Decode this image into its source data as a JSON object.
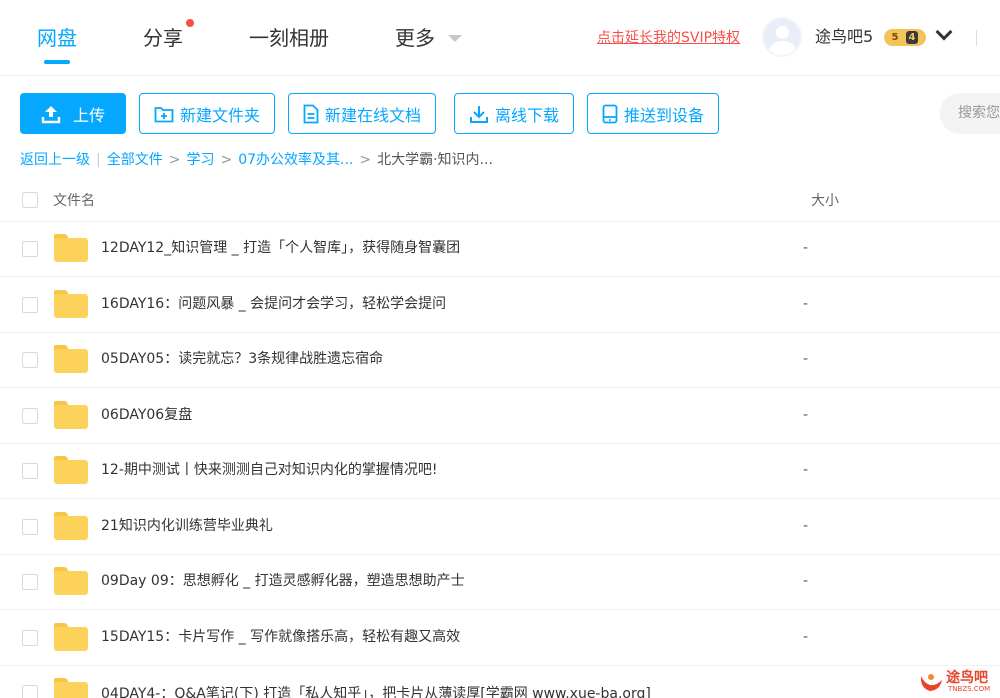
{
  "nav": {
    "tabs": [
      {
        "label": "网盘",
        "active": true
      },
      {
        "label": "分享",
        "has_dot": true
      },
      {
        "label": "一刻相册"
      },
      {
        "label": "更多"
      }
    ],
    "svip_link": "点击延长我的SVIP特权",
    "user": {
      "name": "途鸟吧5",
      "badge_level": "5",
      "badge_count": "4"
    }
  },
  "toolbar": {
    "upload": "上传",
    "new_folder": "新建文件夹",
    "new_doc": "新建在线文档",
    "offline_download": "离线下载",
    "push_device": "推送到设备",
    "search_placeholder": "搜索您"
  },
  "breadcrumb": {
    "back": "返回上一级",
    "items": [
      "全部文件",
      "学习",
      "07办公效率及其...",
      "北大学霸·知识内..."
    ]
  },
  "table": {
    "col_name": "文件名",
    "col_size": "大小",
    "rows": [
      {
        "name": "12DAY12_知识管理 _ 打造「个人智库」，获得随身智囊团",
        "size": "-"
      },
      {
        "name": "16DAY16：问题风暴 _ 会提问才会学习，轻松学会提问",
        "size": "-"
      },
      {
        "name": "05DAY05：读完就忘？3条规律战胜遗忘宿命",
        "size": "-"
      },
      {
        "name": "06DAY06复盘",
        "size": "-"
      },
      {
        "name": "12-期中测试丨快来测测自己对知识内化的掌握情况吧!",
        "size": "-"
      },
      {
        "name": "21知识内化训练营毕业典礼",
        "size": "-"
      },
      {
        "name": "09Day 09：思想孵化 _ 打造灵感孵化器，塑造思想助产士",
        "size": "-"
      },
      {
        "name": "15DAY15：卡片写作 _ 写作就像搭乐高，轻松有趣又高效",
        "size": "-"
      },
      {
        "name": "04DAY4-：Q&A笔记(下) 打造「私人知乎」，把卡片从薄读厚[学霸网 www.xue-ba.org]",
        "size": ""
      }
    ]
  },
  "watermark": {
    "text": "途鸟吧",
    "sub": "TNBZS.COM"
  },
  "colors": {
    "accent": "#06a7ff",
    "red": "#f5504a",
    "folder": "#fdd25a"
  }
}
